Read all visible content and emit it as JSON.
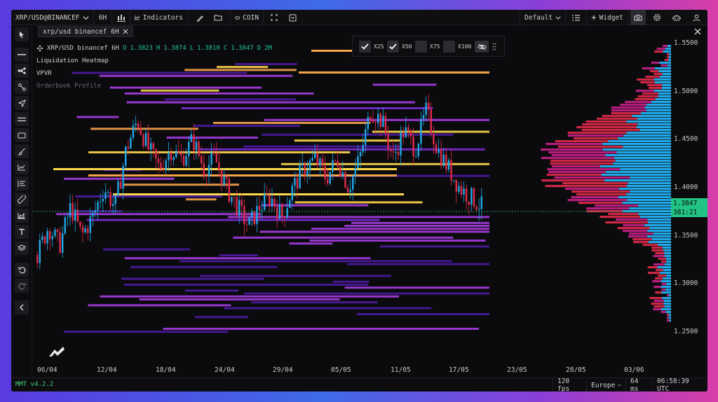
{
  "toolbar": {
    "symbol": "XRP/USD@BINANCEF",
    "interval": "6H",
    "indicators_label": "Indicators",
    "coin_label": "COIN",
    "layout_label": "Default",
    "widget_label": "Widget"
  },
  "tab": {
    "label": "xrp/usd binancef 6H"
  },
  "legend": {
    "symbol_line": "XRP/USD binancef 6H",
    "ohlc": {
      "o_k": "O",
      "o": "1.3823",
      "h_k": "H",
      "h": "1.3874",
      "l_k": "L",
      "l": "1.3810",
      "c_k": "C",
      "c": "1.3847",
      "d_k": "D",
      "d": "2M"
    },
    "indicators": [
      "Liquidation Heatmap",
      "VPVR",
      "Orderbook Profile"
    ]
  },
  "overlay_toggles": [
    {
      "label": "X25",
      "checked": true
    },
    {
      "label": "X50",
      "checked": true
    },
    {
      "label": "X75",
      "checked": false
    },
    {
      "label": "X100",
      "checked": false
    }
  ],
  "price_axis": {
    "ticks": [
      {
        "label": "1.5500",
        "value": 1.55
      },
      {
        "label": "1.5000",
        "value": 1.5
      },
      {
        "label": "1.4500",
        "value": 1.45
      },
      {
        "label": "1.4000",
        "value": 1.4
      },
      {
        "label": "1.3500",
        "value": 1.35
      },
      {
        "label": "1.3000",
        "value": 1.3
      },
      {
        "label": "1.2500",
        "value": 1.25
      }
    ],
    "current_price": "1.3847",
    "countdown": "381:21",
    "current_color": "#22c485"
  },
  "time_axis": [
    "06/04",
    "12/04",
    "18/04",
    "24/04",
    "29/04",
    "05/05",
    "11/05",
    "17/05",
    "23/05",
    "28/05",
    "03/06"
  ],
  "statusbar": {
    "version": "MMT v4.2.2",
    "fps": "120 fps",
    "region": "Europe",
    "latency": "64 ms",
    "clock": "06:58:39 UTC"
  },
  "colors": {
    "up": "#22a8e8",
    "down": "#e02a4a",
    "heat_low": "#4a1aa0",
    "heat_mid": "#a43ce0",
    "heat_high": "#f5a34a",
    "heat_max": "#ffd84a"
  }
}
